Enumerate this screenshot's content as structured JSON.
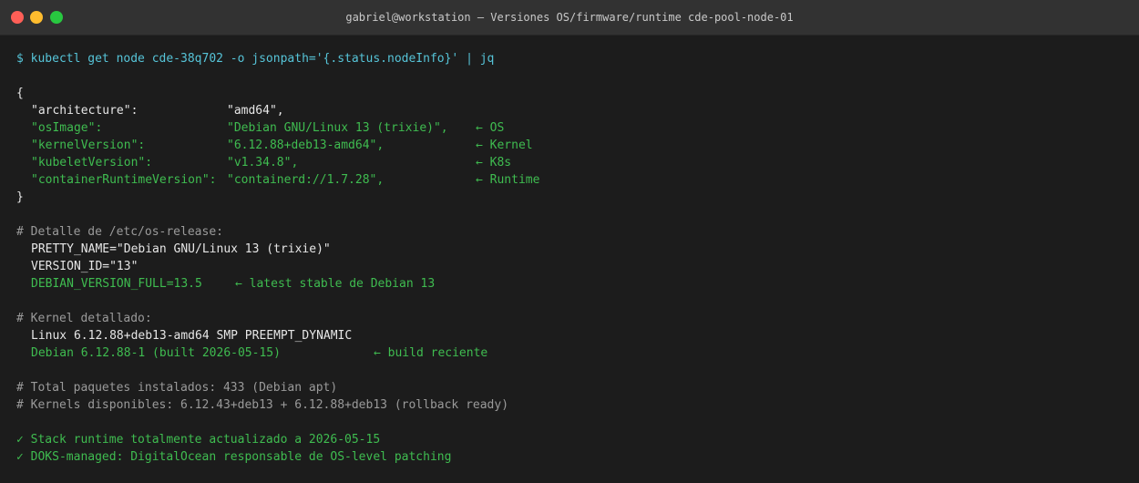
{
  "window": {
    "title": "gabriel@workstation — Versiones OS/firmware/runtime cde-pool-node-01",
    "traffic_colors": {
      "close": "#ff5f57",
      "minimize": "#febc2e",
      "maximize": "#28c840"
    }
  },
  "terminal": {
    "command": "$ kubectl get node cde-38q702 -o jsonpath='{.status.nodeInfo}' | jq",
    "json_open": "{",
    "json_close": "}",
    "node_info": [
      {
        "key": "\"architecture\":",
        "value": "\"amd64\",",
        "note": "",
        "highlight": false
      },
      {
        "key": "\"osImage\":",
        "value": "\"Debian GNU/Linux 13 (trixie)\",",
        "note": "← OS",
        "highlight": true
      },
      {
        "key": "\"kernelVersion\":",
        "value": "\"6.12.88+deb13-amd64\",",
        "note": "← Kernel",
        "highlight": true
      },
      {
        "key": "\"kubeletVersion\":",
        "value": "\"v1.34.8\",",
        "note": "← K8s",
        "highlight": true
      },
      {
        "key": "\"containerRuntimeVersion\":",
        "value": "\"containerd://1.7.28\",",
        "note": "← Runtime",
        "highlight": true
      }
    ],
    "os_release": {
      "comment": "# Detalle de /etc/os-release:",
      "pretty_name": "PRETTY_NAME=\"Debian GNU/Linux 13 (trixie)\"",
      "version_id": "VERSION_ID=\"13\"",
      "version_full": "DEBIAN_VERSION_FULL=13.5",
      "version_full_note": "← latest stable de Debian 13"
    },
    "kernel": {
      "comment": "# Kernel detallado:",
      "uname": "Linux 6.12.88+deb13-amd64 SMP PREEMPT_DYNAMIC",
      "build": "Debian 6.12.88-1 (built 2026-05-15)",
      "build_note": "← build reciente"
    },
    "packages": {
      "total": "# Total paquetes instalados: 433 (Debian apt)",
      "kernels": "# Kernels disponibles: 6.12.43+deb13 + 6.12.88+deb13 (rollback ready)"
    },
    "summary": [
      "✓ Stack runtime totalmente actualizado a 2026-05-15",
      "✓ DOKS-managed: DigitalOcean responsable de OS-level patching"
    ]
  }
}
